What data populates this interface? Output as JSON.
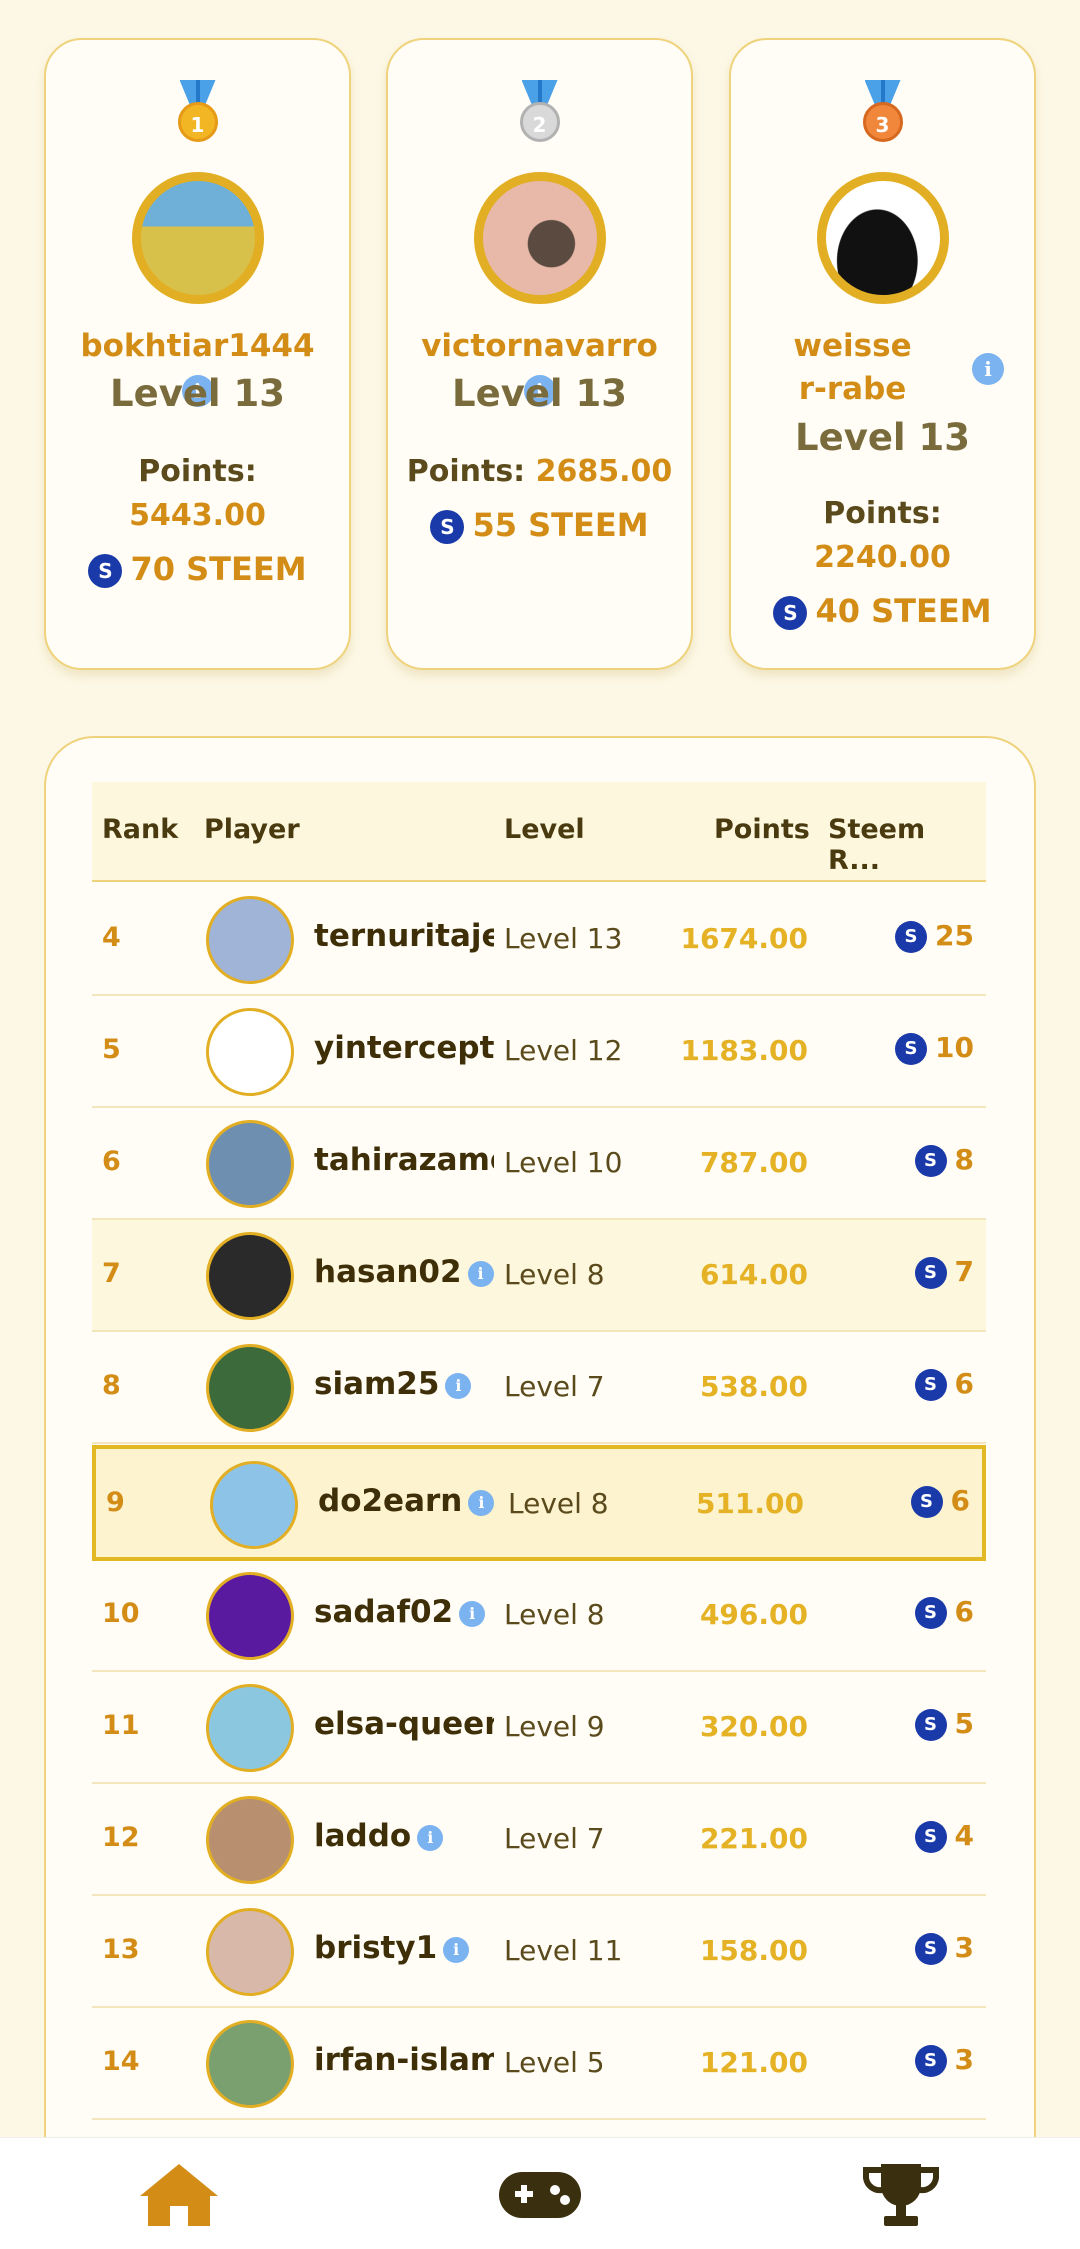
{
  "podium": [
    {
      "place": "1",
      "medal": "gold",
      "name": "bokhtiar1444",
      "level": "Level 13",
      "points_label": "Points:",
      "points": "5443.00",
      "steem": "70 STEEM"
    },
    {
      "place": "2",
      "medal": "silver",
      "name": "victornavarro",
      "level": "Level 13",
      "points_label": "Points:",
      "points": "2685.00",
      "steem": "55 STEEM"
    },
    {
      "place": "3",
      "medal": "bronze",
      "name": "weisser-rabe",
      "level": "Level 13",
      "points_label": "Points:",
      "points": "2240.00",
      "steem": "40 STEEM"
    }
  ],
  "table": {
    "headers": {
      "rank": "Rank",
      "player": "Player",
      "level": "Level",
      "points": "Points",
      "reward": "Steem R..."
    },
    "rows": [
      {
        "rank": "4",
        "player": "ternuritajes",
        "level": "Level 13",
        "points": "1674.00",
        "reward": "25",
        "avatar_color": "#9fb4d6"
      },
      {
        "rank": "5",
        "player": "yintercept",
        "level": "Level 12",
        "points": "1183.00",
        "reward": "10",
        "avatar_color": "#ffffff"
      },
      {
        "rank": "6",
        "player": "tahirazamo",
        "level": "Level 10",
        "points": "787.00",
        "reward": "8",
        "avatar_color": "#6f8fb0"
      },
      {
        "rank": "7",
        "player": "hasan02",
        "level": "Level 8",
        "points": "614.00",
        "reward": "7",
        "avatar_color": "#2a2a2a"
      },
      {
        "rank": "8",
        "player": "siam25",
        "level": "Level 7",
        "points": "538.00",
        "reward": "6",
        "avatar_color": "#3d6a3a"
      },
      {
        "rank": "9",
        "player": "do2earn",
        "level": "Level 8",
        "points": "511.00",
        "reward": "6",
        "avatar_color": "#8ec3e8"
      },
      {
        "rank": "10",
        "player": "sadaf02",
        "level": "Level 8",
        "points": "496.00",
        "reward": "6",
        "avatar_color": "#5a1aa0"
      },
      {
        "rank": "11",
        "player": "elsa-queen",
        "level": "Level 9",
        "points": "320.00",
        "reward": "5",
        "avatar_color": "#8cc7e0"
      },
      {
        "rank": "12",
        "player": "laddo",
        "level": "Level 7",
        "points": "221.00",
        "reward": "4",
        "avatar_color": "#b89070"
      },
      {
        "rank": "13",
        "player": "bristy1",
        "level": "Level 11",
        "points": "158.00",
        "reward": "3",
        "avatar_color": "#d8b8a8"
      },
      {
        "rank": "14",
        "player": "irfan-islam",
        "level": "Level 5",
        "points": "121.00",
        "reward": "3",
        "avatar_color": "#7aa070"
      }
    ]
  },
  "nav": {
    "items": [
      "home-icon",
      "gamepad-icon",
      "trophy-icon"
    ],
    "active_color": "#d38d16",
    "inactive_color": "#3a2f0e"
  }
}
